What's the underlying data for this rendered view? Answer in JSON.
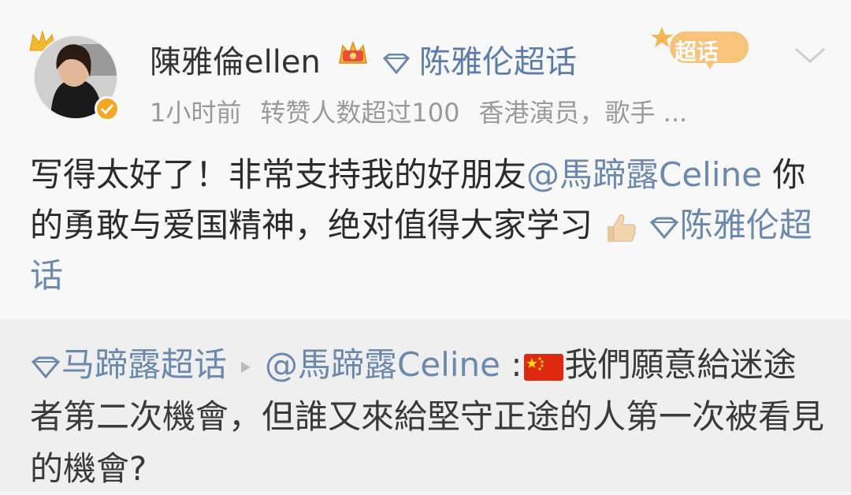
{
  "post": {
    "author": "陳雅倫ellen",
    "topic_head": "陈雅伦超话",
    "badge_label": "超话",
    "meta": {
      "time": "1小时前",
      "reposts": "转赞人数超过100",
      "bio": "香港演员，歌手 ..."
    },
    "text_part1": "写得太好了！非常支持我的好朋友",
    "mention": "@馬蹄露Celine",
    "text_part2": " 你的勇敢与爱国精神，绝对值得大家学习",
    "topic": "陈雅伦超话"
  },
  "repost": {
    "topic": "马蹄露超话",
    "mention": "@馬蹄露Celine",
    "colon": " :",
    "text": "我們願意給迷途者第二次機會，但誰又來給堅守正途的人第一次被看見的機會?"
  },
  "colors": {
    "link": "#6b88ad",
    "accent": "#f5a623",
    "flag_red": "#de2910",
    "flag_star": "#ffde00"
  },
  "icons": [
    "crown-icon",
    "verified-icon",
    "vip-crown-icon",
    "diamond-icon",
    "super-topic-badge-icon",
    "chevron-down-icon",
    "thumbs-up-icon",
    "play-arrow-icon",
    "china-flag-icon"
  ]
}
